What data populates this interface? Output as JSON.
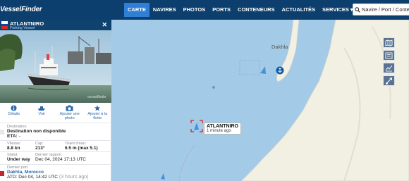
{
  "app": {
    "logo": "VesselFinder"
  },
  "nav": {
    "items": [
      {
        "label": "CARTE",
        "active": true
      },
      {
        "label": "NAVIRES"
      },
      {
        "label": "PHOTOS"
      },
      {
        "label": "PORTS"
      },
      {
        "label": "CONTENEURS"
      },
      {
        "label": "ACTUALITÉS"
      },
      {
        "label": "SERVICES ▾"
      }
    ]
  },
  "search": {
    "placeholder": "Navire / Port / Conteneur"
  },
  "vessel": {
    "name": "ATLANTNIRO",
    "type": "Fishing Vessel",
    "flag_colors": [
      "#ffffff",
      "#1c3fa8",
      "#d52b1e"
    ],
    "photo_watermark": "vesselfinder"
  },
  "actions": [
    {
      "icon": "info-icon",
      "label": "Détails"
    },
    {
      "icon": "ship-icon",
      "label": "Voir"
    },
    {
      "icon": "camera-icon",
      "label": "Ajouter une photo"
    },
    {
      "icon": "star-icon",
      "label": "Ajouter à la flotte"
    }
  ],
  "details": {
    "destination_label": "Destination",
    "destination_value": "Destination non disponible",
    "eta_label": "ETA:",
    "eta_value": "-",
    "speed_label": "Vitesse:",
    "speed_value": "8.8 kn",
    "course_label": "Cap:",
    "course_value": "213°",
    "draught_label": "Tirant d'eau:",
    "draught_value": "6.5 m (max 5.1)",
    "status_label": "Statut:",
    "status_value": "Under way",
    "report_label": "Dernier rapport",
    "report_value": "Dec 04, 2024 17:13 UTC",
    "last_port_label": "Dernier port",
    "last_port_value": "Dakhla, Morocco",
    "atd_label": "ATD:",
    "atd_value": "Dec 04, 14:42 UTC",
    "atd_ago": "(3 hours ago)"
  },
  "map": {
    "place_label": "Dakhla",
    "vessel_label": "ATLANTNIRO",
    "vessel_time": "1 minute ago",
    "controls": [
      "map-layers-icon",
      "legend-icon",
      "weather-icon",
      "route-icon"
    ],
    "colors": {
      "sea": "#a3cbe8",
      "land": "#f2efe3",
      "highlight": "#e02020",
      "vessel": "#4a90d9"
    }
  }
}
